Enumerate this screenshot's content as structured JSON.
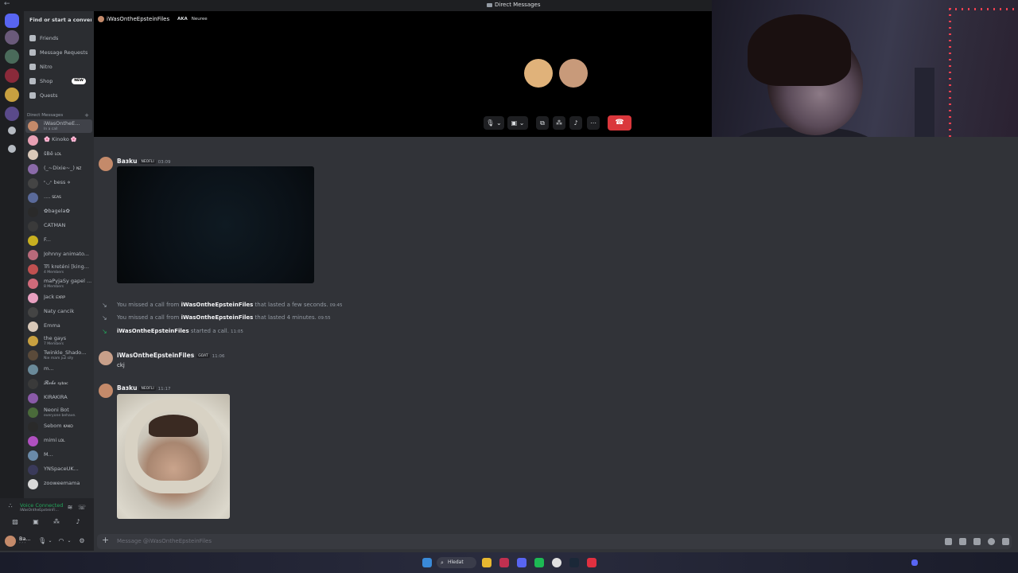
{
  "window": {
    "back_glyph": "←",
    "title": "Direct Messages"
  },
  "sidebar": {
    "search_label": "Find or start a conversati...",
    "nav": [
      {
        "label": "Friends",
        "icon": "friends-icon"
      },
      {
        "label": "Message Requests",
        "icon": "message-requests-icon"
      },
      {
        "label": "Nitro",
        "icon": "nitro-icon"
      },
      {
        "label": "Shop",
        "icon": "shop-icon",
        "badge": "NEW"
      },
      {
        "label": "Quests",
        "icon": "quests-icon"
      }
    ],
    "dm_header": "Direct Messages",
    "dm_header_plus": "+",
    "dms": [
      {
        "name": "iWasOntheE...",
        "sub": "In a call",
        "color": "#c48a6a"
      },
      {
        "name": "🌸 Kinoko 🌸",
        "sub": "",
        "color": "#e8a0b4"
      },
      {
        "name": "šBê",
        "sub": "",
        "tag": "LOL",
        "color": "#d9c8b8"
      },
      {
        "name": "(_~Dixie~_)",
        "sub": "",
        "tag": "NZ",
        "color": "#8a6aa8"
      },
      {
        "name": "ᶜ◡ᶜ bess ⋄",
        "sub": "",
        "color": "#444"
      },
      {
        "name": "....",
        "sub": "",
        "tag": "SEAS",
        "color": "#5a6a9a"
      },
      {
        "name": "✿bagela✿",
        "sub": "",
        "color": "#2a2a2a"
      },
      {
        "name": "CATMAN",
        "sub": "",
        "color": "#3a3a3a"
      },
      {
        "name": "F...",
        "sub": "",
        "color": "#c8b020"
      },
      {
        "name": "Johnny animato...",
        "sub": "",
        "color": "#b86a7a"
      },
      {
        "name": "Tři kreténi [king...",
        "sub": "4 Members",
        "color": "#c05050"
      },
      {
        "name": "maPyjaSy gapel ...",
        "sub": "8 Members",
        "color": "#d06a7a"
      },
      {
        "name": "Jack",
        "sub": "",
        "tag": "EXRP",
        "color": "#e8a0c0"
      },
      {
        "name": "Naty cancik",
        "sub": "",
        "color": "#444"
      },
      {
        "name": "Emma",
        "sub": "",
        "color": "#d8c8b8"
      },
      {
        "name": "the gays",
        "sub": "7 Members",
        "color": "#c8a040"
      },
      {
        "name": "Twinkle_Shado...",
        "sub": "Nie mam już siły",
        "color": "#5a4a3a"
      },
      {
        "name": "m...",
        "sub": "",
        "color": "#6a8a9a"
      },
      {
        "name": "𝓡𝓸𝓫𝓸",
        "sub": "",
        "tag": "sybac",
        "color": "#3a3a3a"
      },
      {
        "name": "KIRAKIRA",
        "sub": "",
        "color": "#8a5aa8"
      },
      {
        "name": "Neoni Bot",
        "sub": "everyone behave.",
        "color": "#4a6a3a"
      },
      {
        "name": "Sebom",
        "sub": "",
        "tag": "KAKO",
        "color": "#2a2a2a"
      },
      {
        "name": "mimi",
        "sub": "",
        "tag": "LOL",
        "color": "#b050c0"
      },
      {
        "name": "M...",
        "sub": "",
        "color": "#6a8aa8"
      },
      {
        "name": "YNSpaceUK...",
        "sub": "",
        "color": "#3a3a5a"
      },
      {
        "name": "zooweemama",
        "sub": "",
        "color": "#d8d8d8"
      }
    ]
  },
  "voice": {
    "status": "Voice Connected",
    "channel": "iWasOntheEpsteinFi..."
  },
  "user": {
    "name": "Ba...",
    "status": "ᐟ ᐟ ᐟ"
  },
  "call": {
    "recipient": "iWasOntheEpsteinFiles",
    "aka_label": "AKA",
    "aka_name": "Neuree",
    "participants": [
      {
        "color": "#e0b27a"
      },
      {
        "color": "#c89a7a"
      }
    ],
    "mic_glyph": "🎙",
    "camera_glyph": "▣",
    "screen_glyph": "⧉",
    "activity_glyph": "⁂",
    "soundboard_glyph": "♪",
    "more_glyph": "⋯",
    "hangup_glyph": "☎"
  },
  "messages": {
    "m1": {
      "author": "Baзku",
      "badge": "NEOFLI",
      "time": "03:09",
      "avatar_color": "#c48a6a"
    },
    "calls": [
      {
        "prefix": "You missed a call from ",
        "name": "iWasOntheEpsteinFiles",
        "suffix": " that lasted a few seconds.",
        "time": "09:45",
        "icon": "missed-call-icon"
      },
      {
        "prefix": "You missed a call from ",
        "name": "iWasOntheEpsteinFiles",
        "suffix": " that lasted 4 minutes.",
        "time": "09:55",
        "icon": "missed-call-icon"
      },
      {
        "prefix": "",
        "name": "iWasOntheEpsteinFiles",
        "suffix": " started a call.",
        "time": "11:05",
        "icon": "call-started-icon"
      }
    ],
    "m2": {
      "author": "iWasOntheEpsteinFiles",
      "badge": "GOAT",
      "time": "11:06",
      "text": "ckj",
      "avatar_color": "#c8a08a"
    },
    "m3": {
      "author": "Baзku",
      "badge": "NEOFLI",
      "time": "11:17",
      "avatar_color": "#c48a6a"
    }
  },
  "composer": {
    "placeholder": "Message @iWasOntheEpsteinFiles",
    "plus": "+"
  },
  "taskbar": {
    "search_label": "Hledat",
    "search_glyph": "⌕"
  }
}
